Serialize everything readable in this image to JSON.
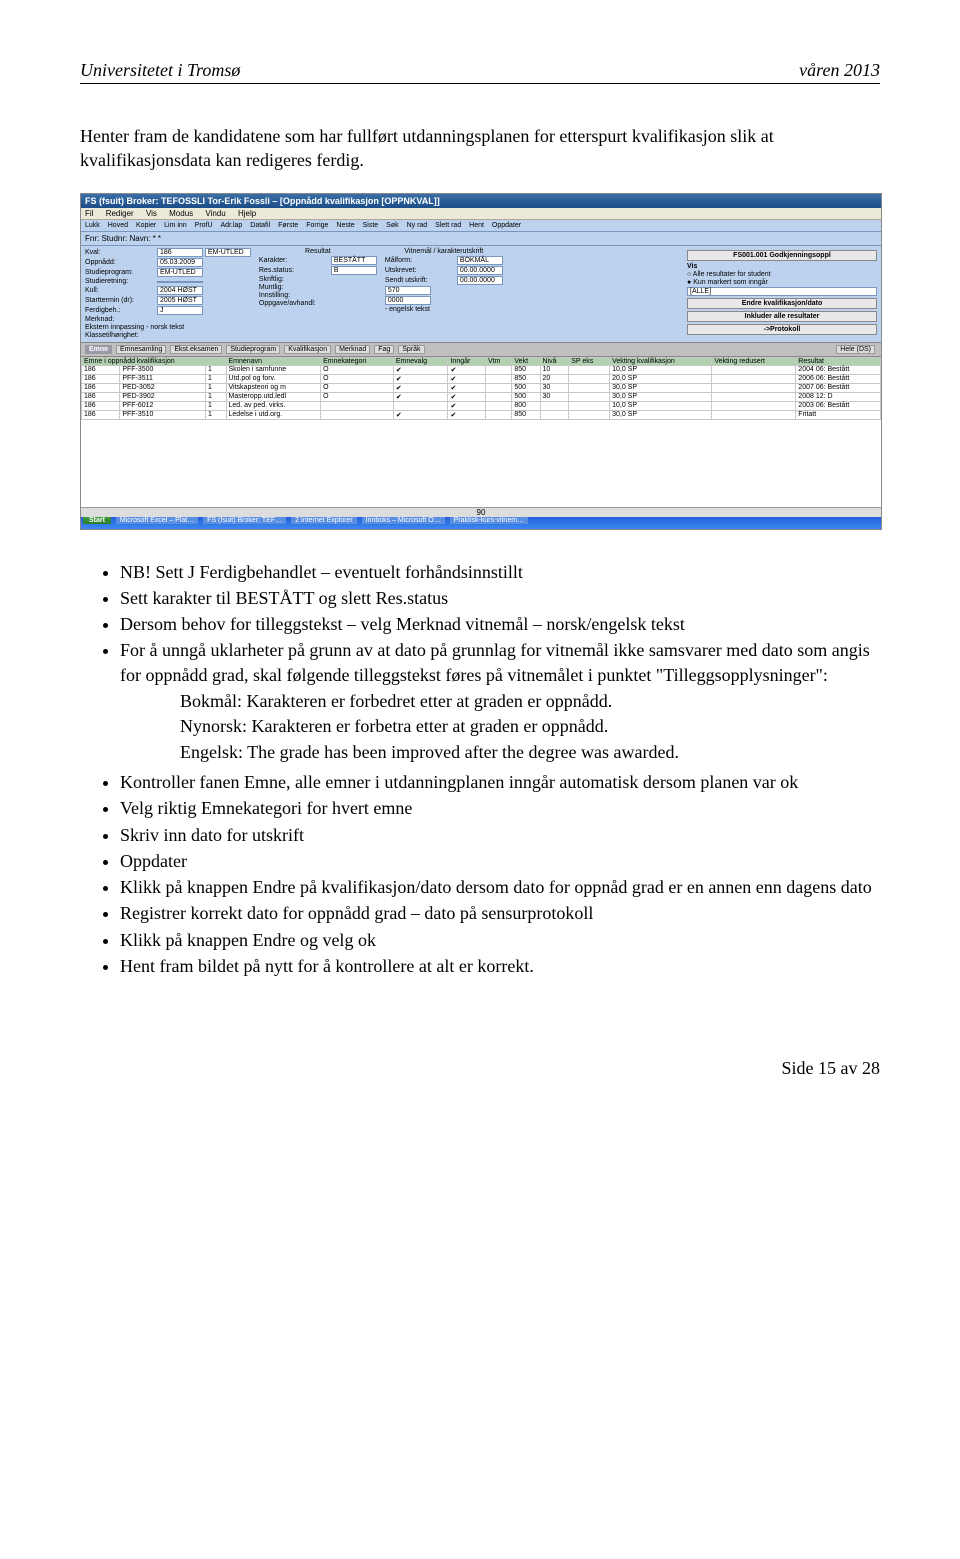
{
  "header": {
    "left": "Universitetet i Tromsø",
    "right": "våren 2013"
  },
  "intro": "Henter fram de kandidatene som har fullført utdanningsplanen for etterspurt kvalifikasjon slik at kvalifikasjonsdata kan redigeres ferdig.",
  "screenshot": {
    "title": "FS (fsuit) Broker: TEFOSSLI Tor-Erik Fossli – [Oppnådd kvalifikasjon [OPPNKVAL]]",
    "menubar": [
      "Fil",
      "Rediger",
      "Vis",
      "Modus",
      "Vindu",
      "Hjelp"
    ],
    "toolbar": [
      "Lukk",
      "Hoved",
      "Kopier",
      "Lim inn",
      "ProfU",
      "Adr.lap",
      "Datafil",
      "Første",
      "Forrige",
      "Neste",
      "Siste",
      "Søk",
      "Ny rad",
      "Slett rad",
      "Hent",
      "Oppdater"
    ],
    "header_row": "Fnr:          Studnr:          Navn:  *   *",
    "form_left": {
      "kval": "186",
      "kval2": "EM-UTLED",
      "oppnadd": "05.03.2009",
      "studieprogram": "EM-UTLED",
      "studieretning": "",
      "kull": "2004   HØST",
      "starttermin": "2005   HØST",
      "ferdigbeh": "J",
      "merknad": ""
    },
    "form_mid": {
      "section": "Resultat",
      "karakter": "BESTÅTT",
      "resstatus": "B",
      "skriftlig": "",
      "muntlig": "",
      "innstilling": "",
      "oppgave": ""
    },
    "form_mid2": {
      "section": "Vitnemål / karakterutskrift",
      "malform": "BOKMÅL",
      "utskrevet": "00.00.0000",
      "sendt": "00.00.0000",
      "field570": "570",
      "field0000": "0000"
    },
    "right": {
      "code": "FS001.001 Godkjenningsoppl",
      "vis_label": "Vis",
      "radio1": "Alle resultater for student",
      "radio2": "Kun markert som inngår",
      "alle": "[ALLE]",
      "btn_endre": "Endre kvalifikasjon/dato",
      "btn_inkluder": "Inkluder alle resultater",
      "btn_protokoll": "->Protokoll"
    },
    "tekst_left_lab": "Ekstern innpassing - norsk tekst",
    "tekst_right_lab": "- engelsk tekst",
    "klasse_lab": "Klassetilhørighet:",
    "tabs": [
      "Emne",
      "Emnesamling",
      "Ekst.eksamen",
      "Studieprogram",
      "Kvalifikasjon",
      "Merknad",
      "Fag",
      "Språk"
    ],
    "tabs_right": "Hele (DS)",
    "grid_headers": [
      "Emne i oppnådd kvalifikasjon",
      "Emnenavn",
      "Emnekategori",
      "Emnevalg",
      "Inngår",
      "Vtm",
      "Vekt",
      "Nivå",
      "SP eks",
      "Vekting kvalifikasjon",
      "Vekting redusert",
      "Resultat"
    ],
    "grid_rows": [
      [
        "186",
        "PFF-3500",
        "1",
        "Skolen i samfunne",
        "O",
        "✔",
        "✔",
        "850",
        "10",
        "10,0 SP",
        "2004 06: Bestått"
      ],
      [
        "186",
        "PFF-3511",
        "1",
        "Utd.pol og forv.",
        "O",
        "✔",
        "✔",
        "850",
        "20",
        "20,0 SP",
        "2006 06: Bestått"
      ],
      [
        "186",
        "PED-3052",
        "1",
        "Vitskapsteori og m",
        "O",
        "✔",
        "✔",
        "500",
        "30",
        "30,0 SP",
        "2007 06: Bestått"
      ],
      [
        "186",
        "PED-3902",
        "1",
        "Masteropp.utd.ledl",
        "O",
        "✔",
        "✔",
        "500",
        "30",
        "30,0 SP",
        "2008 12: D"
      ],
      [
        "186",
        "PFF-6012",
        "1",
        "Led. av ped. virks.",
        "",
        "",
        "✔",
        "800",
        "",
        "10,0 SP",
        "2003 06: Bestått"
      ],
      [
        "186",
        "PFF-3510",
        "1",
        "Ledelse i utd.org.",
        "",
        "✔",
        "✔",
        "850",
        "",
        "30,0 SP",
        "Fritatt"
      ]
    ],
    "footer90": "90",
    "taskbar_start": "Start",
    "taskbar_items": [
      "Microsoft Excel – Plat…",
      "FS (fsuit) Broker: TEF…",
      "2 Internet Explorer",
      "Innboks – Microsoft O…",
      "Praktisk-kurs-vitnem…"
    ]
  },
  "bullets": [
    "NB! Sett J Ferdigbehandlet – eventuelt forhåndsinnstillt",
    "Sett karakter til BESTÅTT og slett Res.status",
    "Dersom behov for tilleggstekst – velg Merknad vitnemål – norsk/engelsk tekst",
    "For å unngå uklarheter på grunn av at dato på grunnlag for vitnemål ikke samsvarer med dato som angis for oppnådd grad, skal følgende tilleggstekst føres på vitnemålet i punktet \"Tilleggsopplysninger\":",
    "Kontroller fanen Emne, alle emner i utdanningplanen inngår automatisk dersom planen var ok",
    "Velg riktig Emnekategori for hvert emne",
    "Skriv inn dato for utskrift",
    "Oppdater",
    "Klikk på knappen Endre på kvalifikasjon/dato dersom dato for oppnåd grad er en annen enn dagens dato",
    "Registrer korrekt dato for oppnådd grad – dato på sensurprotokoll",
    "Klikk på knappen Endre og velg ok",
    "Hent fram bildet på nytt for å kontrollere at alt er korrekt."
  ],
  "sub_bullets": [
    "Bokmål: Karakteren er forbedret etter at graden er oppnådd.",
    "Nynorsk: Karakteren er forbetra etter at graden er oppnådd.",
    "Engelsk: The grade has been improved after the degree was awarded."
  ],
  "footer": "Side 15 av 28"
}
